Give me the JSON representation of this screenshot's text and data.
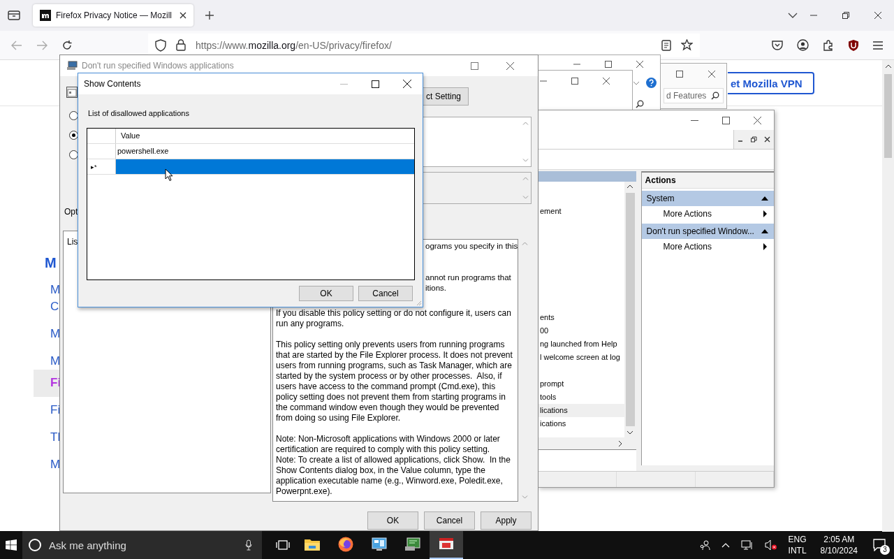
{
  "browser": {
    "tab": {
      "title": "Firefox Privacy Notice — Mozill"
    },
    "url": {
      "prefix": "https://www.",
      "host": "mozilla.org",
      "path": "/en-US/privacy/firefox/"
    },
    "vpn_button": "et Mozilla VPN",
    "sidebar": {
      "heading": "M",
      "items": [
        {
          "lines": [
            "M",
            "C"
          ],
          "selected": false
        },
        {
          "lines": [
            "M"
          ],
          "selected": false
        },
        {
          "lines": [
            "M"
          ],
          "selected": false
        },
        {
          "lines": [
            "Fi"
          ],
          "selected": true
        },
        {
          "lines": [
            "Fi"
          ],
          "selected": false
        },
        {
          "lines": [
            "Tl"
          ],
          "selected": false
        },
        {
          "lines": [
            "M"
          ],
          "selected": false
        }
      ]
    }
  },
  "background_windows": {
    "search": {
      "placeholder": "d Features"
    }
  },
  "gp_editor": {
    "list_groups": [
      [
        {
          "text": "ement",
          "selected": false
        }
      ],
      [
        {
          "text": "ents",
          "selected": false
        },
        {
          "text": "00",
          "selected": false
        },
        {
          "text": "ng launched from Help",
          "selected": false
        },
        {
          "text": "l welcome screen at log",
          "selected": false
        }
      ],
      [
        {
          "text": "prompt",
          "selected": false
        },
        {
          "text": "tools",
          "selected": false
        },
        {
          "text": "lications",
          "selected": true
        },
        {
          "text": "ications",
          "selected": false
        }
      ]
    ],
    "actions": {
      "title": "Actions",
      "sections": [
        {
          "title": "System",
          "items": [
            "More Actions"
          ]
        },
        {
          "title": "Don't run specified Window...",
          "items": [
            "More Actions"
          ]
        }
      ]
    }
  },
  "policy_dialog": {
    "title": "Don't run specified Windows applications",
    "next_button": "ct Setting",
    "radios": [
      {
        "selected": false
      },
      {
        "selected": true
      },
      {
        "selected": false
      }
    ],
    "options_label": "Opt",
    "options_text": "Lis",
    "help_partial_lines": [
      "ograms you specify in this",
      "annot run programs that",
      "itions."
    ],
    "help_paragraphs": [
      "If you disable this policy setting or do not configure it, users can run any programs.",
      "This policy setting only prevents users from running programs that are started by the File Explorer process. It does not prevent users from running programs, such as Task Manager, which are started by the system process or by other processes.  Also, if users have access to the command prompt (Cmd.exe), this policy setting does not prevent them from starting programs in the command window even though they would be prevented from doing so using File Explorer.",
      "Note: Non-Microsoft applications with Windows 2000 or later certification are required to comply with this policy setting.\nNote: To create a list of allowed applications, click Show.  In the Show Contents dialog box, in the Value column, type the application executable name (e.g., Winword.exe, Poledit.exe, Powerpnt.exe)."
    ],
    "buttons": [
      "OK",
      "Cancel",
      "Apply"
    ]
  },
  "show_contents": {
    "title": "Show Contents",
    "label": "List of disallowed applications",
    "column": "Value",
    "rows": [
      {
        "value": "powershell.exe",
        "selected": false
      },
      {
        "marker": "▸*",
        "selected": true
      }
    ],
    "buttons": [
      "OK",
      "Cancel"
    ]
  },
  "taskbar": {
    "search": {
      "placeholder": "Ask me anything"
    },
    "apps": [
      {
        "kind": "explorer",
        "selected": false
      },
      {
        "kind": "firefox",
        "selected": false
      },
      {
        "kind": "monitor",
        "selected": false
      },
      {
        "kind": "gpedit",
        "selected": false
      },
      {
        "kind": "policy",
        "selected": true
      }
    ],
    "language": [
      "ENG",
      "INTL"
    ],
    "time": "2:05 AM",
    "date": "8/10/2024",
    "notifications": "3"
  }
}
